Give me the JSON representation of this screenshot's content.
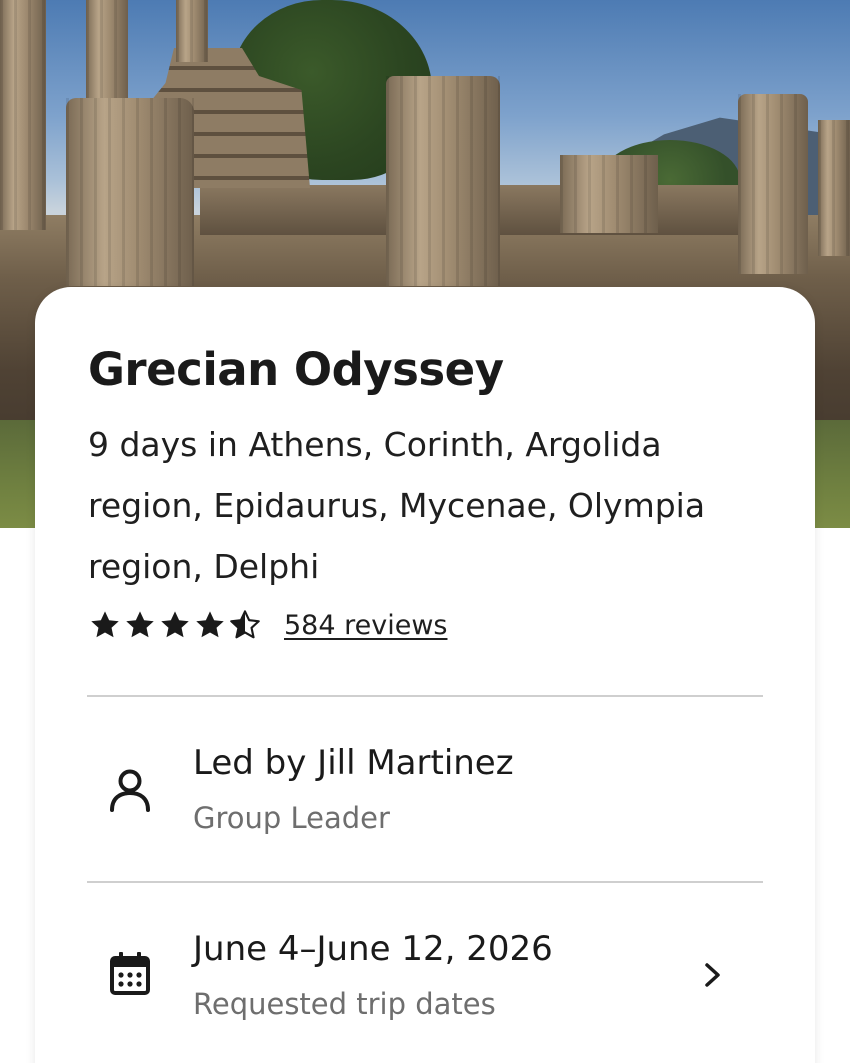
{
  "hero": {
    "image_subject": "ancient-greek-temple-ruins-photo"
  },
  "trip": {
    "title": "Grecian Odyssey",
    "subtitle": "9 days in Athens, Corinth, Argolida region, Epidaurus, Mycenae, Olympia region, Delphi",
    "rating": {
      "stars": 4.5,
      "max_stars": 5,
      "reviews_label": "584 reviews"
    }
  },
  "leader": {
    "icon": "person-icon",
    "name_label": "Led by Jill Martinez",
    "role_label": "Group Leader"
  },
  "dates": {
    "icon": "calendar-icon",
    "range_label": "June 4–June 12, 2026",
    "caption": "Requested trip dates",
    "action_icon": "chevron-right-icon"
  },
  "colors": {
    "text_primary": "#1a1a1a",
    "text_secondary": "#6e6e6e",
    "divider": "#cfcfcf",
    "card_background": "#ffffff"
  }
}
